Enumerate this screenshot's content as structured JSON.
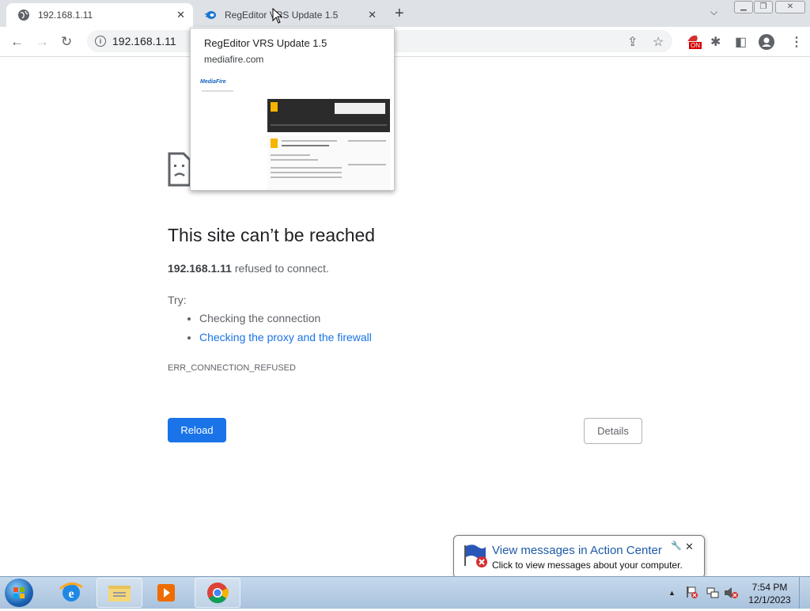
{
  "tabs": [
    {
      "title": "192.168.1.11",
      "active": true
    },
    {
      "title": "RegEditor VRS Update 1.5",
      "active": false
    }
  ],
  "toolbar": {
    "url": "192.168.1.11"
  },
  "hover_card": {
    "title": "RegEditor VRS Update 1.5",
    "domain": "mediafire.com",
    "thumb_logo": "MediaFire"
  },
  "error_page": {
    "title": "This site can’t be reached",
    "host": "192.168.1.11",
    "refused_suffix": " refused to connect.",
    "try_label": "Try:",
    "suggestions": [
      "Checking the connection",
      "Checking the proxy and the firewall"
    ],
    "error_code": "ERR_CONNECTION_REFUSED",
    "reload_label": "Reload",
    "details_label": "Details"
  },
  "extension_badge": "ON",
  "balloon": {
    "title": "View messages in Action Center",
    "text": "Click to view messages about your computer."
  },
  "clock": {
    "time": "7:54 PM",
    "date": "12/1/2023"
  },
  "colors": {
    "accent": "#1a73e8",
    "tabstrip": "#dee1e6",
    "taskbar": "#b4cbe3"
  }
}
